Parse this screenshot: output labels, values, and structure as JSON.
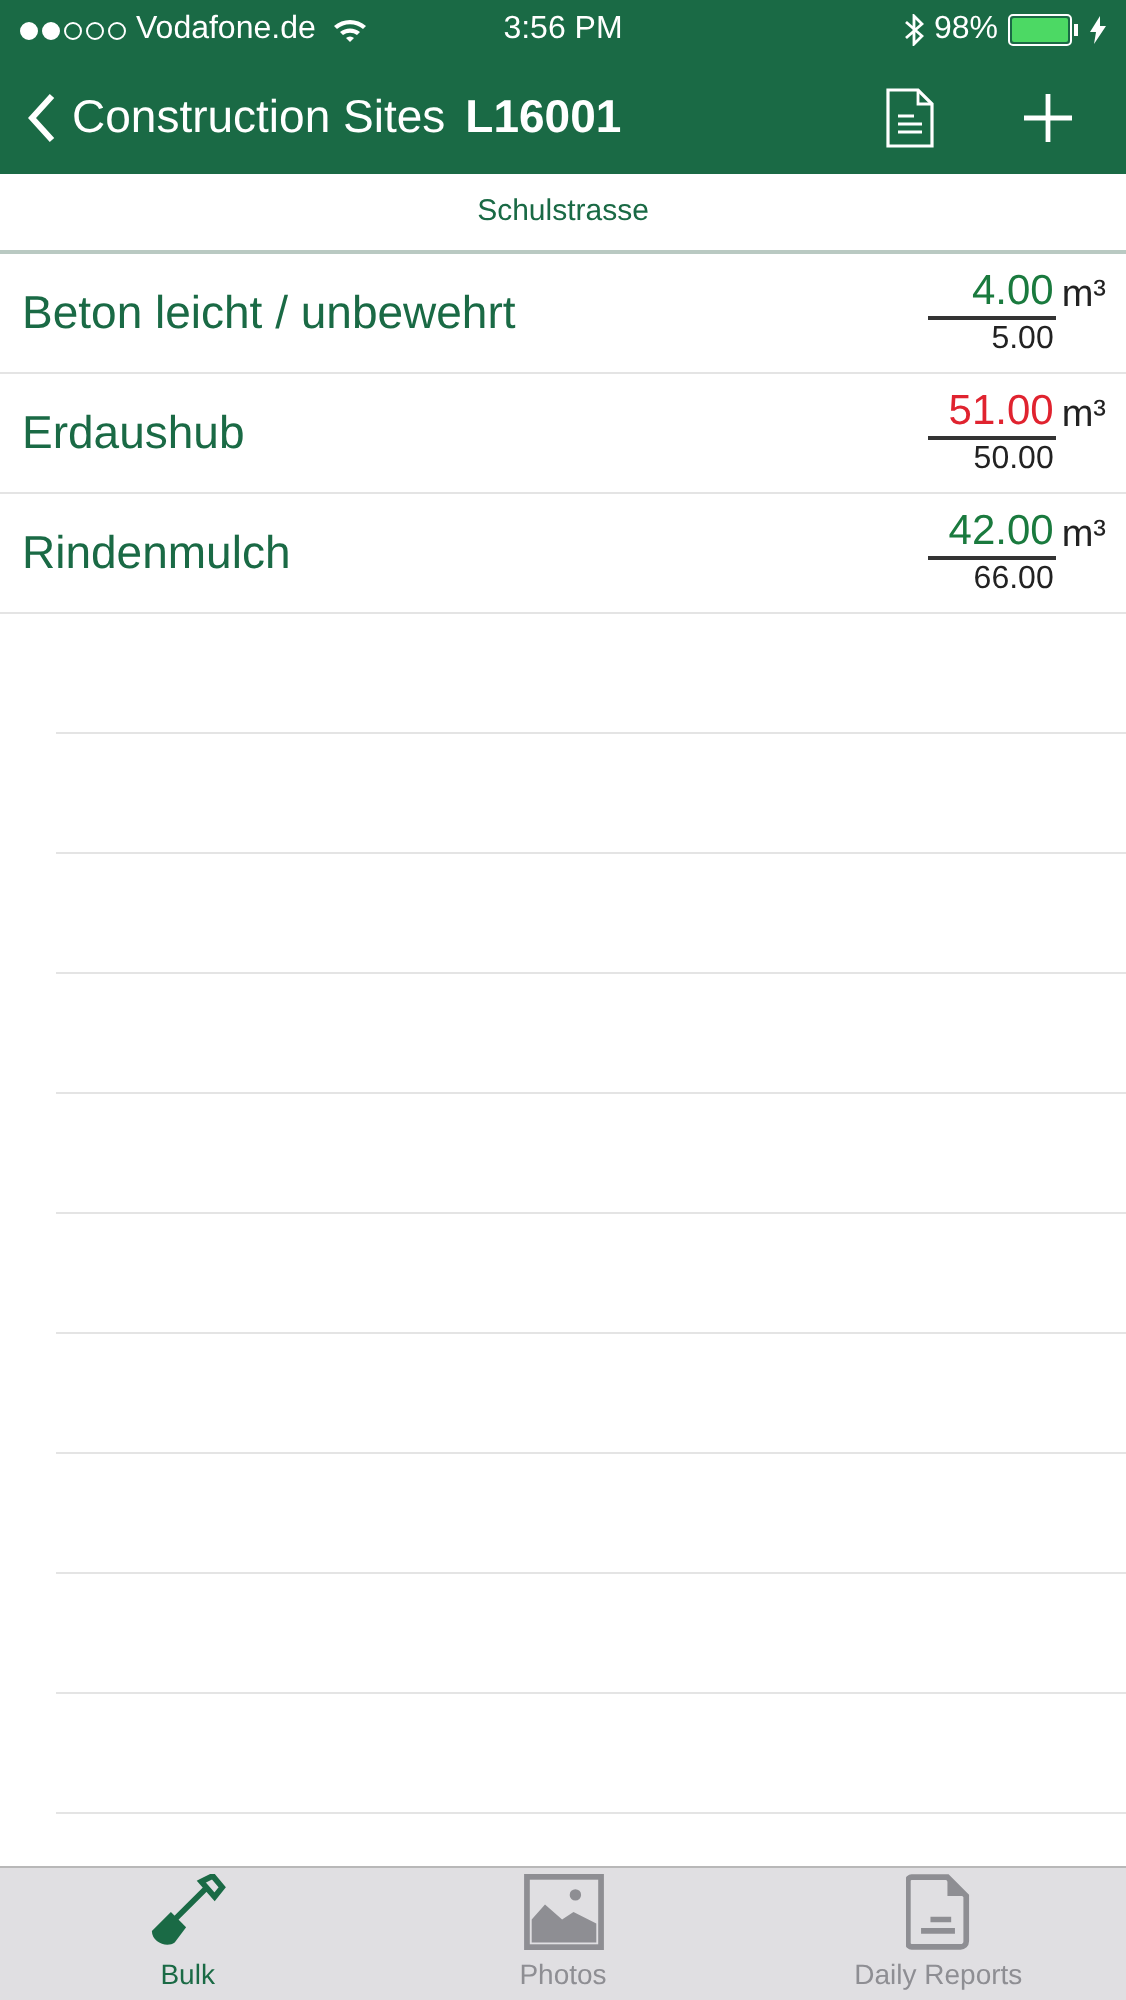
{
  "status_bar": {
    "signal_dots": [
      {
        "filled": true
      },
      {
        "filled": true
      },
      {
        "filled": false
      },
      {
        "filled": false
      },
      {
        "filled": false
      }
    ],
    "carrier": "Vodafone.de",
    "time": "3:56 PM",
    "battery": "98%"
  },
  "nav": {
    "back_label": "Construction Sites",
    "title": "L16001"
  },
  "subheader": "Schulstrasse",
  "items": [
    {
      "name": "Beton leicht / unbewehrt",
      "actual": "4.00",
      "planned": "5.00",
      "unit": "m³",
      "exceeded": false
    },
    {
      "name": "Erdaushub",
      "actual": "51.00",
      "planned": "50.00",
      "unit": "m³",
      "exceeded": true
    },
    {
      "name": "Rindenmulch",
      "actual": "42.00",
      "planned": "66.00",
      "unit": "m³",
      "exceeded": false
    }
  ],
  "tabs": [
    {
      "label": "Bulk",
      "kind": "shovel",
      "selected": true
    },
    {
      "label": "Photos",
      "kind": "photo",
      "selected": false
    },
    {
      "label": "Daily Reports",
      "kind": "report",
      "selected": false
    }
  ]
}
